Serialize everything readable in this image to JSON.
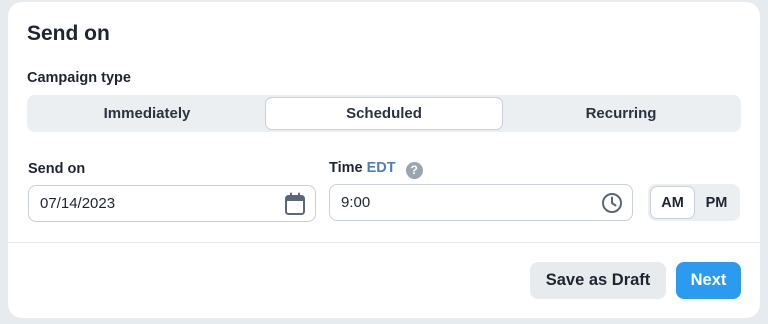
{
  "card": {
    "title": "Send on",
    "campaign_type_label": "Campaign type",
    "campaign_types": [
      "Immediately",
      "Scheduled",
      "Recurring"
    ],
    "selected_campaign_type": "Scheduled",
    "send_on_label": "Send on",
    "date_value": "07/14/2023",
    "time_label": "Time",
    "timezone": "EDT",
    "help_glyph": "?",
    "time_value": "9:00",
    "am_label": "AM",
    "pm_label": "PM",
    "selected_meridiem": "AM",
    "save_draft_label": "Save as Draft",
    "next_label": "Next"
  },
  "colors": {
    "accent": "#2b9bf0",
    "timezone": "#4f7fb3",
    "background": "#e6ebf0"
  },
  "icons": {
    "date": "calendar-icon",
    "time": "clock-icon",
    "help": "help-circle-icon"
  }
}
